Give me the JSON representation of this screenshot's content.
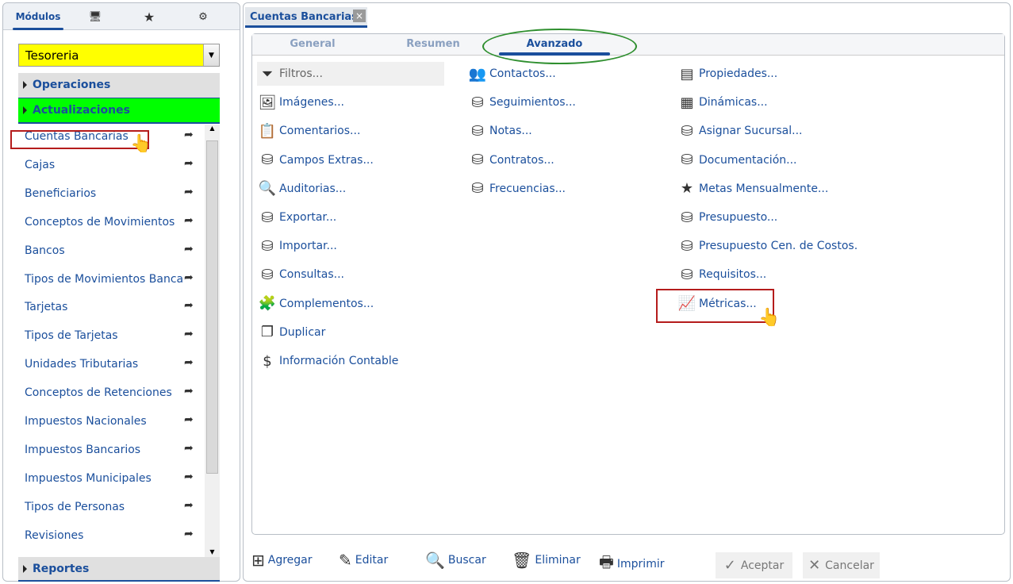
{
  "left": {
    "tabs": [
      {
        "label": "Módulos",
        "icon": "module"
      },
      {
        "label": "",
        "icon": "monitor-icon"
      },
      {
        "label": "",
        "icon": "star-icon"
      },
      {
        "label": "",
        "icon": "gear-window-icon"
      }
    ],
    "module_select": "Tesoreria",
    "sections": {
      "operaciones": "Operaciones",
      "actualizaciones": "Actualizaciones",
      "reportes": "Reportes"
    },
    "items": [
      "Cuentas Bancarias",
      "Cajas",
      "Beneficiarios",
      "Conceptos de Movimientos",
      "Bancos",
      "Tipos de Movimientos Bancarios",
      "Tarjetas",
      "Tipos de Tarjetas",
      "Unidades Tributarias",
      "Conceptos de Retenciones",
      "Impuestos Nacionales",
      "Impuestos Bancarios",
      "Impuestos Municipales",
      "Tipos de Personas",
      "Revisiones"
    ]
  },
  "window": {
    "tab": "Cuentas Bancarias",
    "close": "×",
    "subtabs": [
      "General",
      "Resumen",
      "Avanzado"
    ],
    "col1": [
      "Filtros...",
      "Imágenes...",
      "Comentarios...",
      "Campos Extras...",
      "Auditorias...",
      "Exportar...",
      "Importar...",
      "Consultas...",
      "Complementos...",
      "Duplicar",
      "Información Contable"
    ],
    "col2": [
      "Contactos...",
      "Seguimientos...",
      "Notas...",
      "Contratos...",
      "Frecuencias..."
    ],
    "col3": [
      "Propiedades...",
      "Dinámicas...",
      "Asignar Sucursal...",
      "Documentación...",
      "Metas Mensualmente...",
      "Presupuesto...",
      "Presupuesto Cen. de Costos.",
      "Requisitos...",
      "Métricas..."
    ],
    "bottom": [
      "Agregar",
      "Editar",
      "Buscar",
      "Eliminar",
      "Imprimir"
    ],
    "accept": "Aceptar",
    "cancel": "Cancelar"
  },
  "colors": {
    "accent": "#1b4f9c",
    "select_bg": "#ffff00",
    "active_section": "#00ff00",
    "highlight": "#b51c1c",
    "ellipse": "#2f8f2f"
  }
}
